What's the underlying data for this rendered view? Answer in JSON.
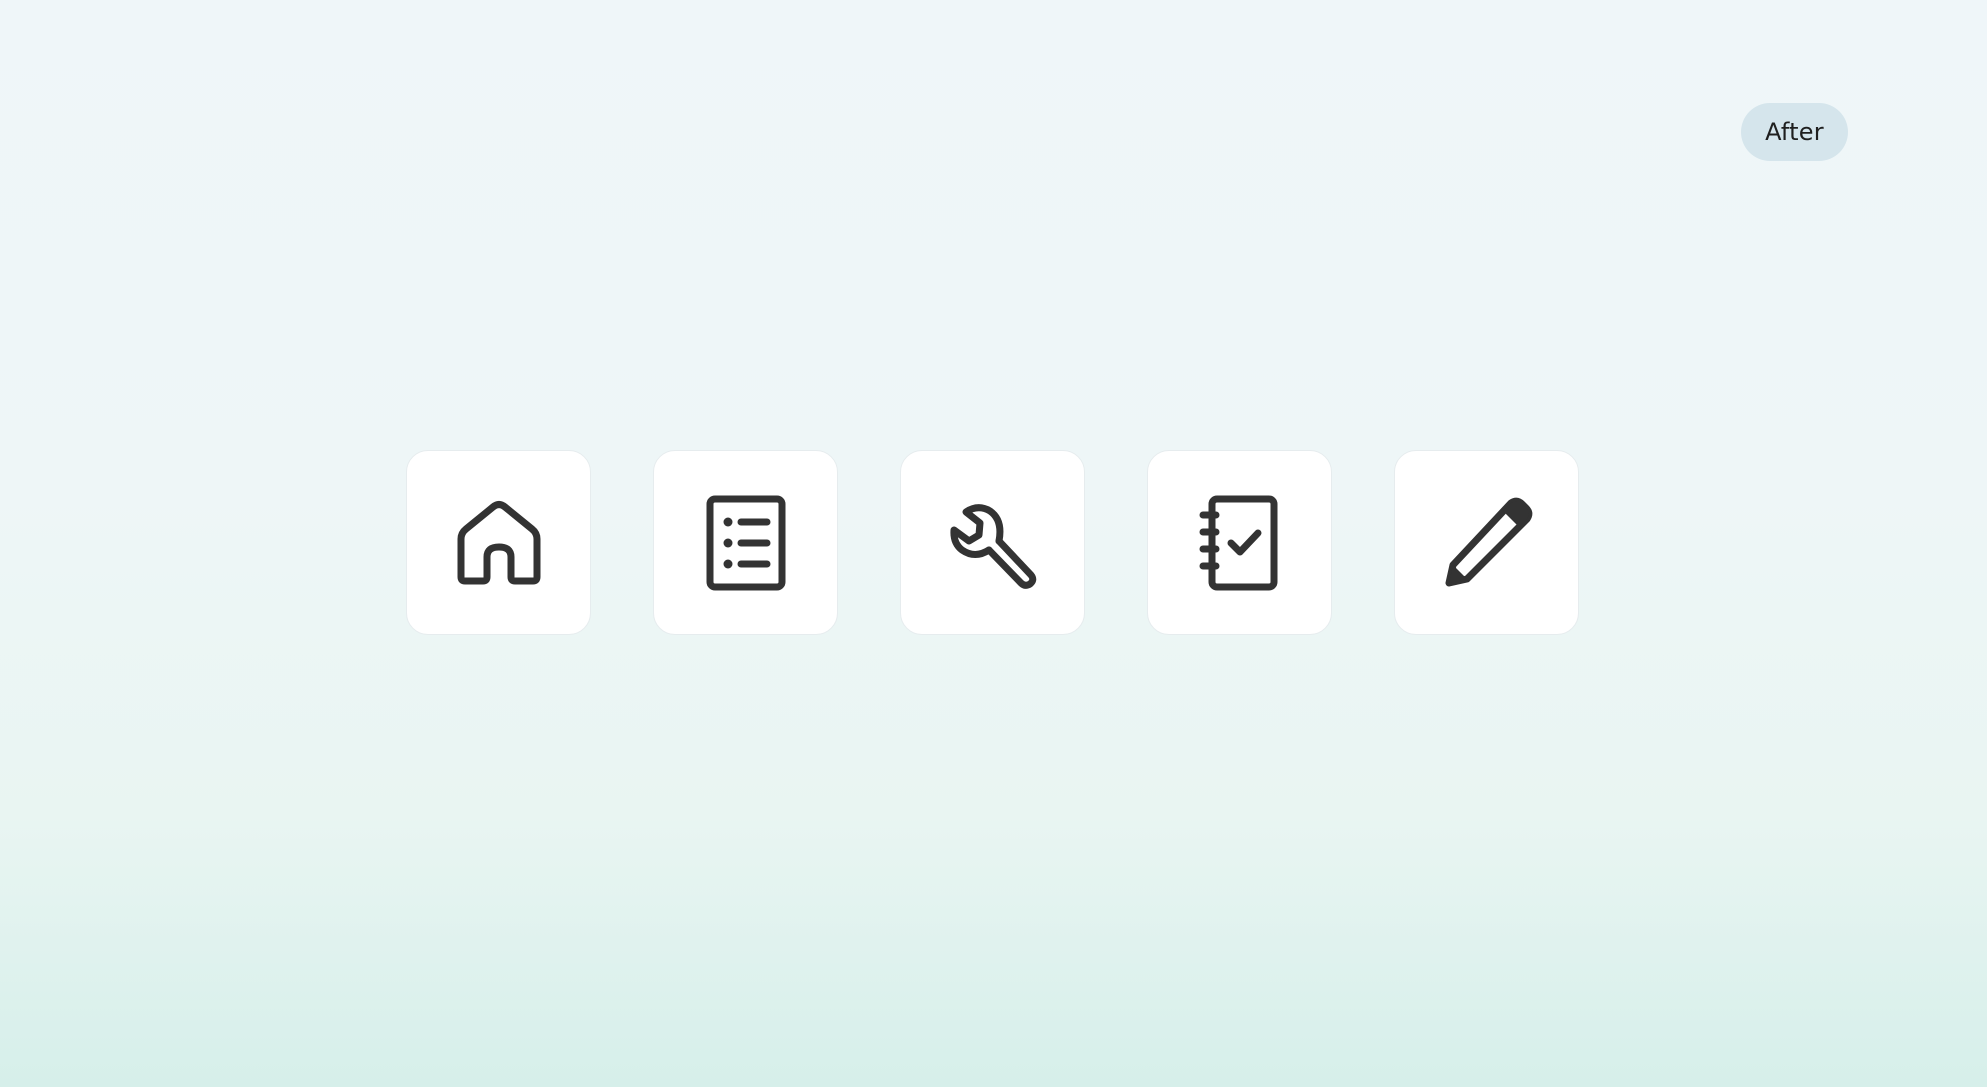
{
  "badge": {
    "label": "After"
  },
  "icons": [
    {
      "name": "home-icon"
    },
    {
      "name": "list-document-icon"
    },
    {
      "name": "wrench-icon"
    },
    {
      "name": "notebook-check-icon"
    },
    {
      "name": "pencil-icon"
    }
  ],
  "colors": {
    "icon_stroke": "#333333",
    "badge_bg": "#d5e5ec",
    "tile_bg": "#ffffff"
  }
}
